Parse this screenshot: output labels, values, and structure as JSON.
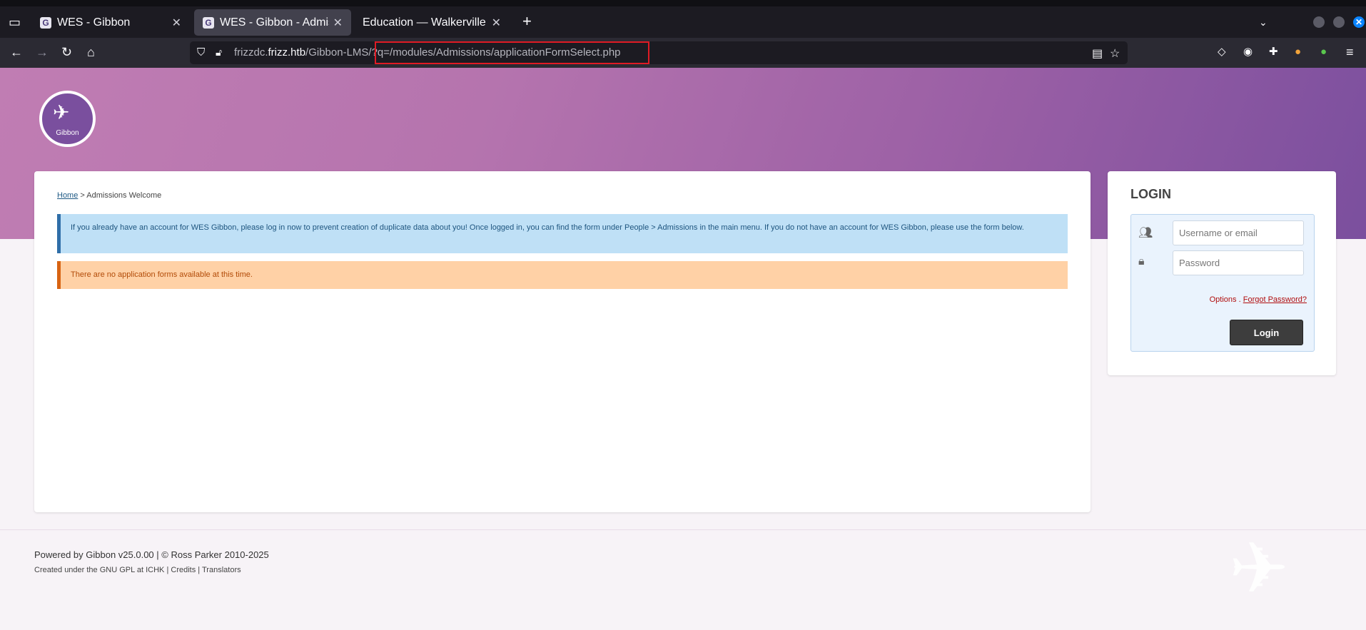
{
  "browser": {
    "tabs": [
      {
        "title": "WES - Gibbon",
        "favicon": "G",
        "active": false
      },
      {
        "title": "WES - Gibbon - Admissions",
        "favicon": "G",
        "active": true
      },
      {
        "title": "Education — Walkerville Elementary",
        "favicon": "",
        "active": false
      }
    ],
    "new_tab_icon": "plus-icon",
    "url": {
      "host_prefix": "frizzdc.",
      "host_main": "frizz.htb",
      "path": "/Gibbon-LMS/",
      "query": "?q=/modules/Admissions/applicationFormSelect.php"
    },
    "highlight_color": "#e01b24"
  },
  "page": {
    "logo_text": "Gibbon",
    "breadcrumb": {
      "home": "Home",
      "separator": ">",
      "current": "Admissions Welcome"
    },
    "info_message": "If you already have an account for WES Gibbon, please log in now to prevent creation of duplicate data about you! Once logged in, you can find the form under People > Admissions in the main menu. If you do not have an account for WES Gibbon, please use the form below.",
    "warning_message": "There are no application forms available at this time.",
    "login": {
      "title": "LOGIN",
      "username_placeholder": "Username or email",
      "password_placeholder": "Password",
      "options_label": "Options",
      "options_separator": ".",
      "forgot_label": "Forgot Password?",
      "submit_label": "Login"
    },
    "footer": {
      "powered": "Powered by Gibbon v25.0.00 | © Ross Parker 2010-2025",
      "created_prefix": "Created under the GNU GPL at ICHK |",
      "credits": "Credits",
      "sep": "|",
      "translators": "Translators"
    }
  },
  "colors": {
    "header_gradient_start": "#c07db3",
    "header_gradient_end": "#7b4f9e",
    "info_bg": "#bfe0f6",
    "warning_bg": "#ffd1a6"
  }
}
